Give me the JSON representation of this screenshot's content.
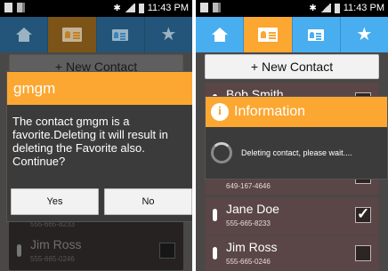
{
  "left": {
    "status": {
      "time": "11:43 PM"
    },
    "tabs": [
      {
        "name": "home",
        "icon": "home-icon",
        "active": false
      },
      {
        "name": "contacts",
        "icon": "contact-card-icon",
        "active": true
      },
      {
        "name": "contacts-list",
        "icon": "contact-card-small-icon",
        "active": false
      },
      {
        "name": "favorites",
        "icon": "star-icon",
        "active": false
      }
    ],
    "new_contact_label": "+ New Contact",
    "contacts": [
      {
        "phone": "555-665-8233"
      },
      {
        "name": "Jim Ross",
        "phone": "555-665-0246",
        "checked": false
      }
    ],
    "dialog": {
      "title": "gmgm",
      "message": "The contact gmgm is a favorite.Deleting it will result in deleting the Favorite also. Continue?",
      "yes_label": "Yes",
      "no_label": "No"
    }
  },
  "right": {
    "status": {
      "time": "11:43 PM"
    },
    "new_contact_label": "+ New Contact",
    "contacts": [
      {
        "name": "Bob Smith",
        "phone": "649-167-4646",
        "checked": false
      },
      {
        "name": "Jane Doe",
        "phone": "555-665-8233",
        "checked": true
      },
      {
        "name": "Jim Ross",
        "phone": "555-665-0246",
        "checked": false
      }
    ],
    "info_dialog": {
      "title": "Information",
      "message": "Deleting contact, please wait...."
    }
  },
  "colors": {
    "accent": "#fba731",
    "tab_blue": "#48aef0",
    "row_bg": "#5a4646"
  }
}
